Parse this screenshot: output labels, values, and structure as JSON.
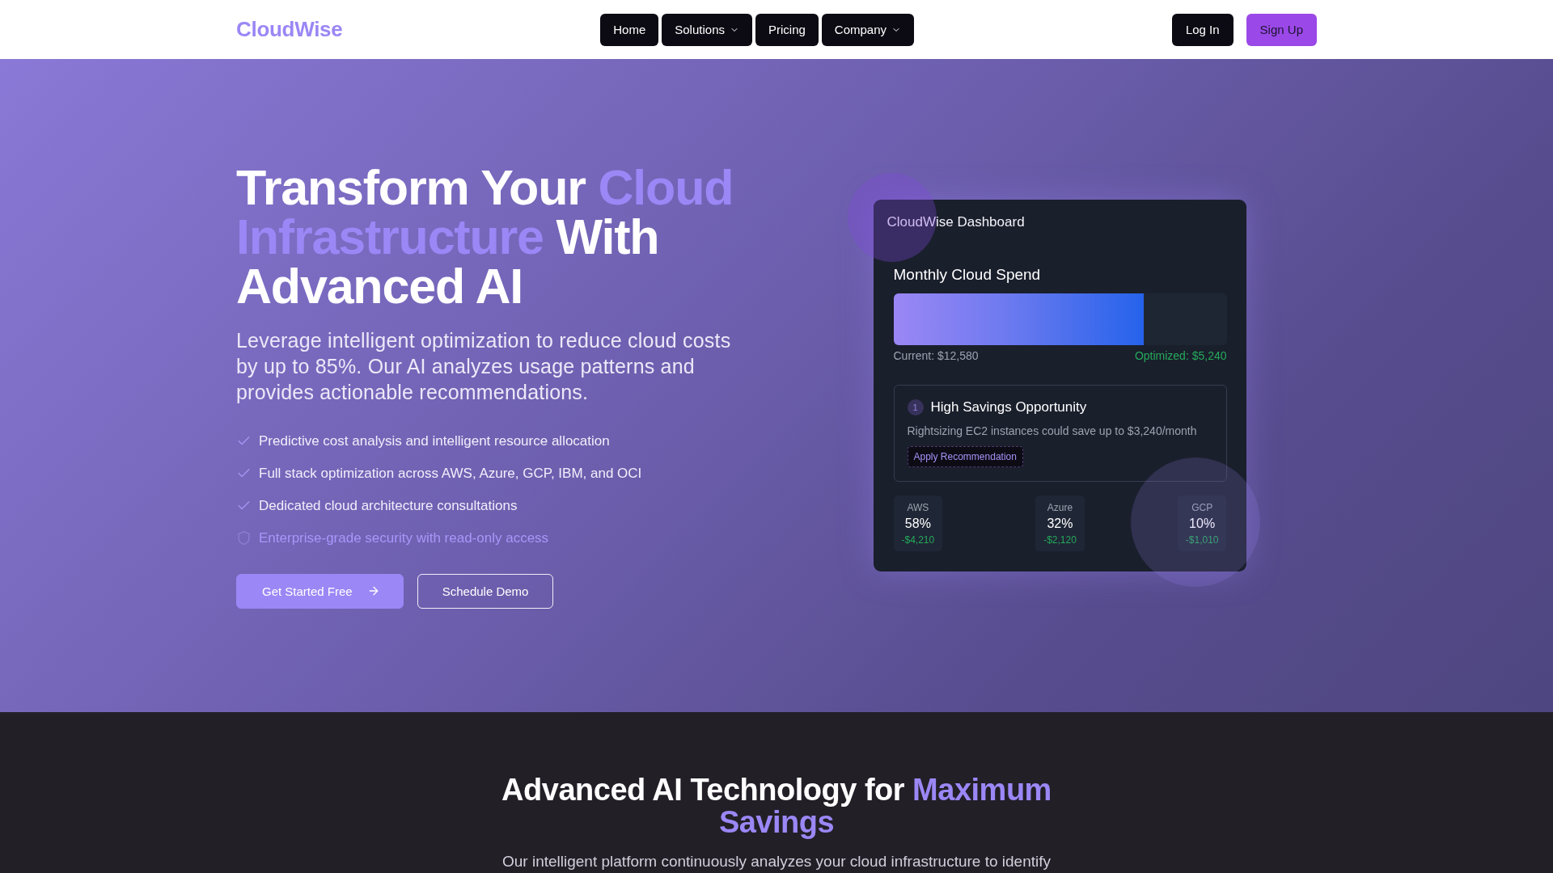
{
  "nav": {
    "logo": "CloudWise",
    "links": [
      {
        "label": "Home",
        "has_menu": false
      },
      {
        "label": "Solutions",
        "has_menu": true
      },
      {
        "label": "Pricing",
        "has_menu": false
      },
      {
        "label": "Company",
        "has_menu": true
      }
    ],
    "actions": [
      {
        "label": "Log In",
        "kind": "secondary"
      },
      {
        "label": "Sign Up",
        "kind": "primary"
      }
    ]
  },
  "hero": {
    "headline": [
      {
        "text": "Transform Your ",
        "accent": false
      },
      {
        "text": "Cloud Infrastructure",
        "accent": true
      },
      {
        "text": " With Advanced AI",
        "accent": false
      }
    ],
    "description": "Leverage intelligent optimization to reduce cloud costs by up to 85%. Our AI analyzes usage patterns and provides actionable recommendations.",
    "features": [
      {
        "text": "Predictive cost analysis and intelligent resource allocation",
        "kind": "check"
      },
      {
        "text": "Full stack optimization across AWS, Azure, GCP, IBM, and OCI",
        "kind": "check"
      },
      {
        "text": "Dedicated cloud architecture consultations",
        "kind": "check"
      },
      {
        "text": "Enterprise-grade security with read-only access",
        "kind": "security"
      }
    ],
    "buttons": [
      {
        "label": "Get Started Free",
        "kind": "primary"
      },
      {
        "label": "Schedule Demo",
        "kind": "outline"
      }
    ]
  },
  "dashboard": {
    "title": "CloudWise Dashboard",
    "spend": {
      "title": "Monthly Cloud Spend",
      "level": 0.75,
      "current": "Current: $12,580",
      "optimized": "Optimized: $5,240"
    },
    "recommendation": {
      "number": "1",
      "title": "High Savings Opportunity",
      "description": "Rightsizing EC2 instances could save up to $3,240/month",
      "button": "Apply Recommendation"
    },
    "providers": [
      {
        "name": "AWS",
        "share": "58%",
        "savings": "-$4,210"
      },
      {
        "name": "Azure",
        "share": "32%",
        "savings": "-$2,120"
      },
      {
        "name": "GCP",
        "share": "10%",
        "savings": "-$1,010"
      }
    ]
  },
  "technology": {
    "heading": [
      {
        "text": "Advanced AI Technology for ",
        "accent": false
      },
      {
        "text": "Maximum Savings",
        "accent": true
      }
    ],
    "description": "Our intelligent platform continuously analyzes your cloud infrastructure to identify"
  }
}
